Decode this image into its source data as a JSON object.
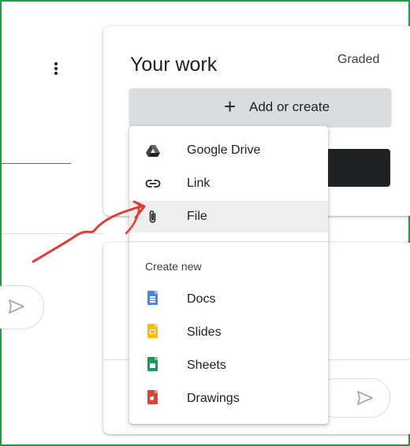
{
  "your_work": {
    "title": "Your work",
    "status": "Graded",
    "add_button": {
      "icon": "plus-icon",
      "label": "Add or create"
    }
  },
  "menu": {
    "attach_items": [
      {
        "label": "Google Drive",
        "icon": "google-drive-icon"
      },
      {
        "label": "Link",
        "icon": "link-icon"
      },
      {
        "label": "File",
        "icon": "paperclip-icon"
      }
    ],
    "create_section_label": "Create new",
    "create_items": [
      {
        "label": "Docs",
        "icon": "google-docs-icon",
        "color": "#4285f4"
      },
      {
        "label": "Slides",
        "icon": "google-slides-icon",
        "color": "#fbbc04"
      },
      {
        "label": "Sheets",
        "icon": "google-sheets-icon",
        "color": "#0f9d58"
      },
      {
        "label": "Drawings",
        "icon": "google-drawings-icon",
        "color": "#db4437"
      }
    ]
  },
  "colors": {
    "frame_border": "#1e9e3e",
    "annotation_arrow": "#e53935",
    "highlight_bg": "#eeeeee"
  }
}
